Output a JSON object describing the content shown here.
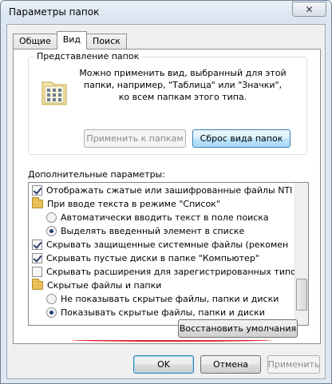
{
  "window": {
    "title": "Параметры папок",
    "close_glyph": "✕"
  },
  "tabs": [
    {
      "label": "Общие"
    },
    {
      "label": "Вид"
    },
    {
      "label": "Поиск"
    }
  ],
  "folder_view": {
    "group_label": "Представление папок",
    "description": "Можно применить вид, выбранный для этой папки, например, \"Таблица\" или \"Значки\", ко всем папкам этого типа.",
    "apply_button": "Применить к папкам",
    "reset_button": "Сброс вида папок",
    "icon": "folder-view-icon"
  },
  "advanced": {
    "label": "Дополнительные параметры:",
    "items": [
      {
        "kind": "checkbox",
        "checked": true,
        "label": "Отображать сжатые или зашифрованные файлы NTI"
      },
      {
        "kind": "folder",
        "label": "При вводе текста в режиме \"Список\""
      },
      {
        "kind": "radio",
        "checked": false,
        "label": "Автоматически вводить текст в поле поиска"
      },
      {
        "kind": "radio",
        "checked": true,
        "label": "Выделять введенный элемент в списке"
      },
      {
        "kind": "checkbox",
        "checked": true,
        "label": "Скрывать защищенные системные файлы (рекомен"
      },
      {
        "kind": "checkbox",
        "checked": true,
        "label": "Скрывать пустые диски в папке \"Компьютер\""
      },
      {
        "kind": "checkbox",
        "checked": false,
        "label": "Скрывать расширения для зарегистрированных типо"
      },
      {
        "kind": "folder",
        "label": "Скрытые файлы и папки"
      },
      {
        "kind": "radio",
        "checked": false,
        "label": "Не показывать скрытые файлы, папки и диски"
      },
      {
        "kind": "radio",
        "checked": true,
        "label": "Показывать скрытые файлы, папки и диски"
      }
    ],
    "restore_button": "Восстановить умолчания"
  },
  "footer": {
    "ok": "OK",
    "cancel": "Отмена",
    "apply": "Применить"
  },
  "colors": {
    "highlight_underline": "#e0232f"
  }
}
